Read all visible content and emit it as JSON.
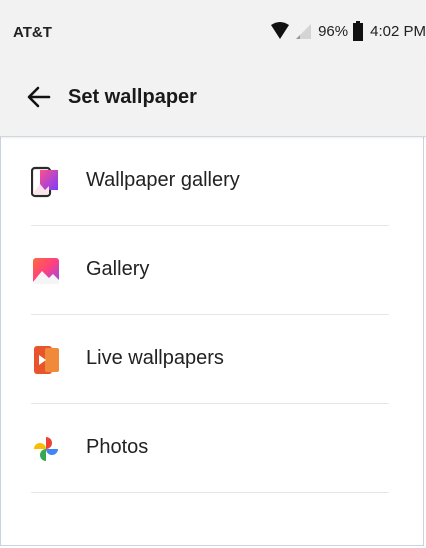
{
  "status_bar": {
    "carrier": "AT&T",
    "battery_percent": "96%",
    "time": "4:02 PM"
  },
  "app_bar": {
    "title": "Set wallpaper"
  },
  "options": [
    {
      "label": "Wallpaper gallery",
      "icon": "wallpaper-gallery-icon"
    },
    {
      "label": "Gallery",
      "icon": "gallery-icon"
    },
    {
      "label": "Live wallpapers",
      "icon": "live-wallpapers-icon"
    },
    {
      "label": "Photos",
      "icon": "google-photos-icon"
    }
  ],
  "colors": {
    "bar_background": "#f2f2f2",
    "divider": "#e6e6e6",
    "text": "#222222"
  }
}
